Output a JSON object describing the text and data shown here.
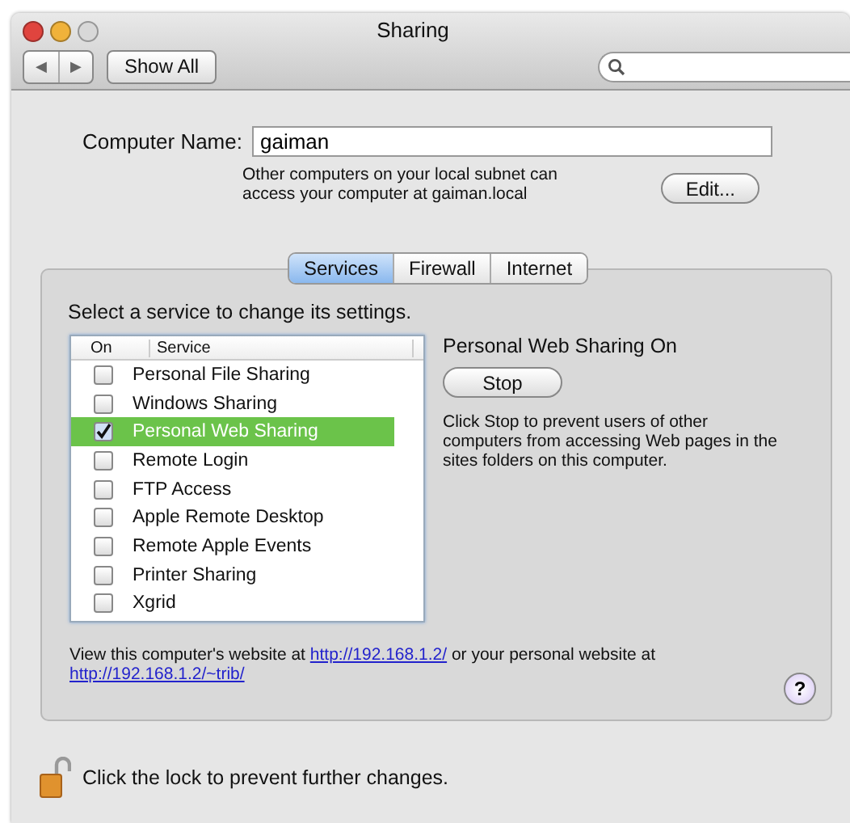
{
  "window": {
    "title": "Sharing"
  },
  "toolbar": {
    "back_forward": {
      "back": "◀",
      "forward": "▶"
    },
    "show_all": "Show All"
  },
  "computer_name": {
    "label": "Computer Name:",
    "value": "gaiman",
    "note": "Other computers on your local subnet can access your computer at gaiman.local",
    "edit_button": "Edit..."
  },
  "tabs": [
    {
      "label": "Services",
      "selected": true
    },
    {
      "label": "Firewall",
      "selected": false
    },
    {
      "label": "Internet",
      "selected": false
    }
  ],
  "instruction": "Select a service to change its settings.",
  "service_table": {
    "columns": [
      "On",
      "Service"
    ],
    "rows": [
      {
        "label": "Personal File Sharing",
        "checked": false,
        "selected": false
      },
      {
        "label": "Windows Sharing",
        "checked": false,
        "selected": false
      },
      {
        "label": "Personal Web Sharing",
        "checked": true,
        "selected": true
      },
      {
        "label": "Remote Login",
        "checked": false,
        "selected": false
      },
      {
        "label": "FTP Access",
        "checked": false,
        "selected": false
      },
      {
        "label": "Apple Remote Desktop",
        "checked": false,
        "selected": false
      },
      {
        "label": "Remote Apple Events",
        "checked": false,
        "selected": false
      },
      {
        "label": "Printer Sharing",
        "checked": false,
        "selected": false
      },
      {
        "label": "Xgrid",
        "checked": false,
        "selected": false
      }
    ]
  },
  "detail": {
    "status": "Personal Web Sharing On",
    "button": "Stop",
    "description": "Click Stop to prevent users of other computers from accessing Web pages in the sites folders on this computer."
  },
  "footer": {
    "text_before": "View this computer's website at",
    "link_1": "http://192.168.1.2/",
    "text_middle": "or your personal website at",
    "link_2": "http://192.168.1.2/~trib/"
  },
  "help": "?",
  "lock": {
    "text": "Click the lock to prevent further changes."
  }
}
